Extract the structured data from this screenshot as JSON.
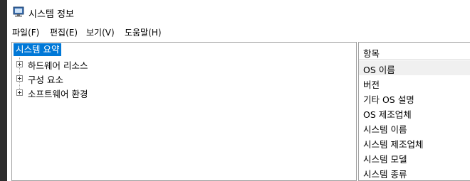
{
  "window": {
    "title": "시스템 정보",
    "accent": "#0078d7"
  },
  "menu": [
    {
      "label": "파일(F)"
    },
    {
      "label": "편집(E)"
    },
    {
      "label": "보기(V)"
    },
    {
      "label": "도움말(H)"
    }
  ],
  "tree": {
    "root": "시스템 요약",
    "children": [
      {
        "label": "하드웨어 리소스",
        "icon": "plus-expander-icon"
      },
      {
        "label": "구성 요소",
        "icon": "plus-expander-icon"
      },
      {
        "label": "소프트웨어 환경",
        "icon": "plus-expander-icon"
      }
    ]
  },
  "list": {
    "header": "항목",
    "rows": [
      {
        "label": "OS 이름"
      },
      {
        "label": "버전"
      },
      {
        "label": "기타 OS 설명"
      },
      {
        "label": "OS 제조업체"
      },
      {
        "label": "시스템 이름"
      },
      {
        "label": "시스템 제조업체"
      },
      {
        "label": "시스템 모델"
      },
      {
        "label": "시스템 종류"
      }
    ]
  }
}
